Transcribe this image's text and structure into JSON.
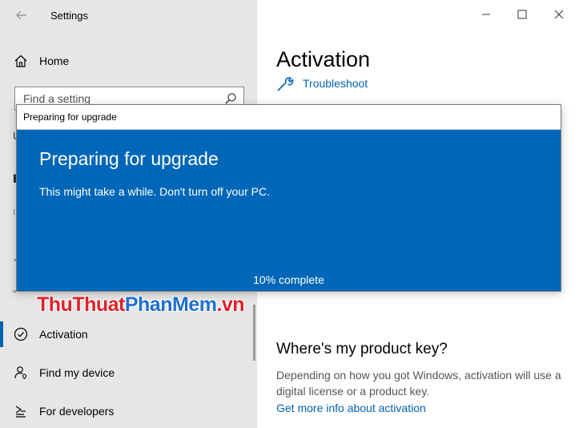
{
  "window": {
    "title": "Settings"
  },
  "sidebar": {
    "home_label": "Home",
    "search_placeholder": "Find a setting",
    "items": [
      {
        "label": "Activation",
        "icon": "check-circle-icon",
        "selected": true
      },
      {
        "label": "Find my device",
        "icon": "person-location-icon"
      },
      {
        "label": "For developers",
        "icon": "developer-icon"
      }
    ]
  },
  "main": {
    "title": "Activation",
    "troubleshoot_label": "Troubleshoot",
    "product_key_heading": "Where's my product key?",
    "product_key_text": "Depending on how you got Windows, activation will use a digital license or a product key.",
    "more_info_link": "Get more info about activation"
  },
  "dialog": {
    "window_title": "Preparing for upgrade",
    "heading": "Preparing for upgrade",
    "message": "This might take a while. Don't turn off your PC.",
    "progress_text": "10% complete",
    "progress_percent": 10
  },
  "watermark": {
    "part1": "ThuThuat",
    "part2": "PhanMem",
    "part3": ".vn"
  },
  "colors": {
    "accent": "#0063b1",
    "dialog_bg": "#0067b8",
    "sidebar_bg": "#e6e6e6"
  }
}
